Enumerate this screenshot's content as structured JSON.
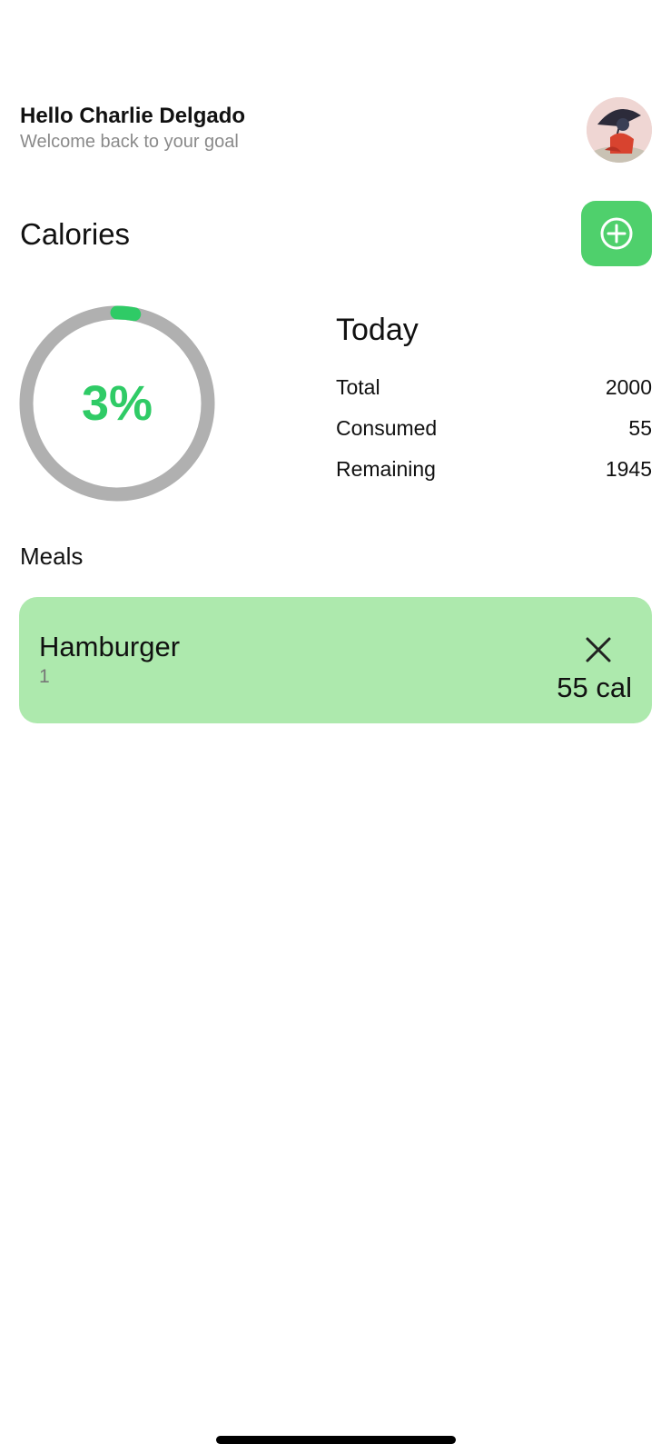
{
  "header": {
    "greeting": "Hello Charlie Delgado",
    "subtitle": "Welcome back to your goal",
    "avatar_icon": "avatar-illustration"
  },
  "calories": {
    "title": "Calories",
    "add_icon": "plus-circle-icon",
    "accent_color": "#4fd06c",
    "progress": {
      "percent_label": "3%",
      "fraction": 0.03
    },
    "today": {
      "title": "Today",
      "rows": [
        {
          "label": "Total",
          "value": "2000"
        },
        {
          "label": "Consumed",
          "value": "55"
        },
        {
          "label": "Remaining",
          "value": "1945"
        }
      ]
    }
  },
  "meals": {
    "title": "Meals",
    "card_color": "#ade9ad",
    "items": [
      {
        "name": "Hamburger",
        "quantity": "1",
        "calories": "55 cal",
        "delete_icon": "close-icon"
      }
    ]
  }
}
